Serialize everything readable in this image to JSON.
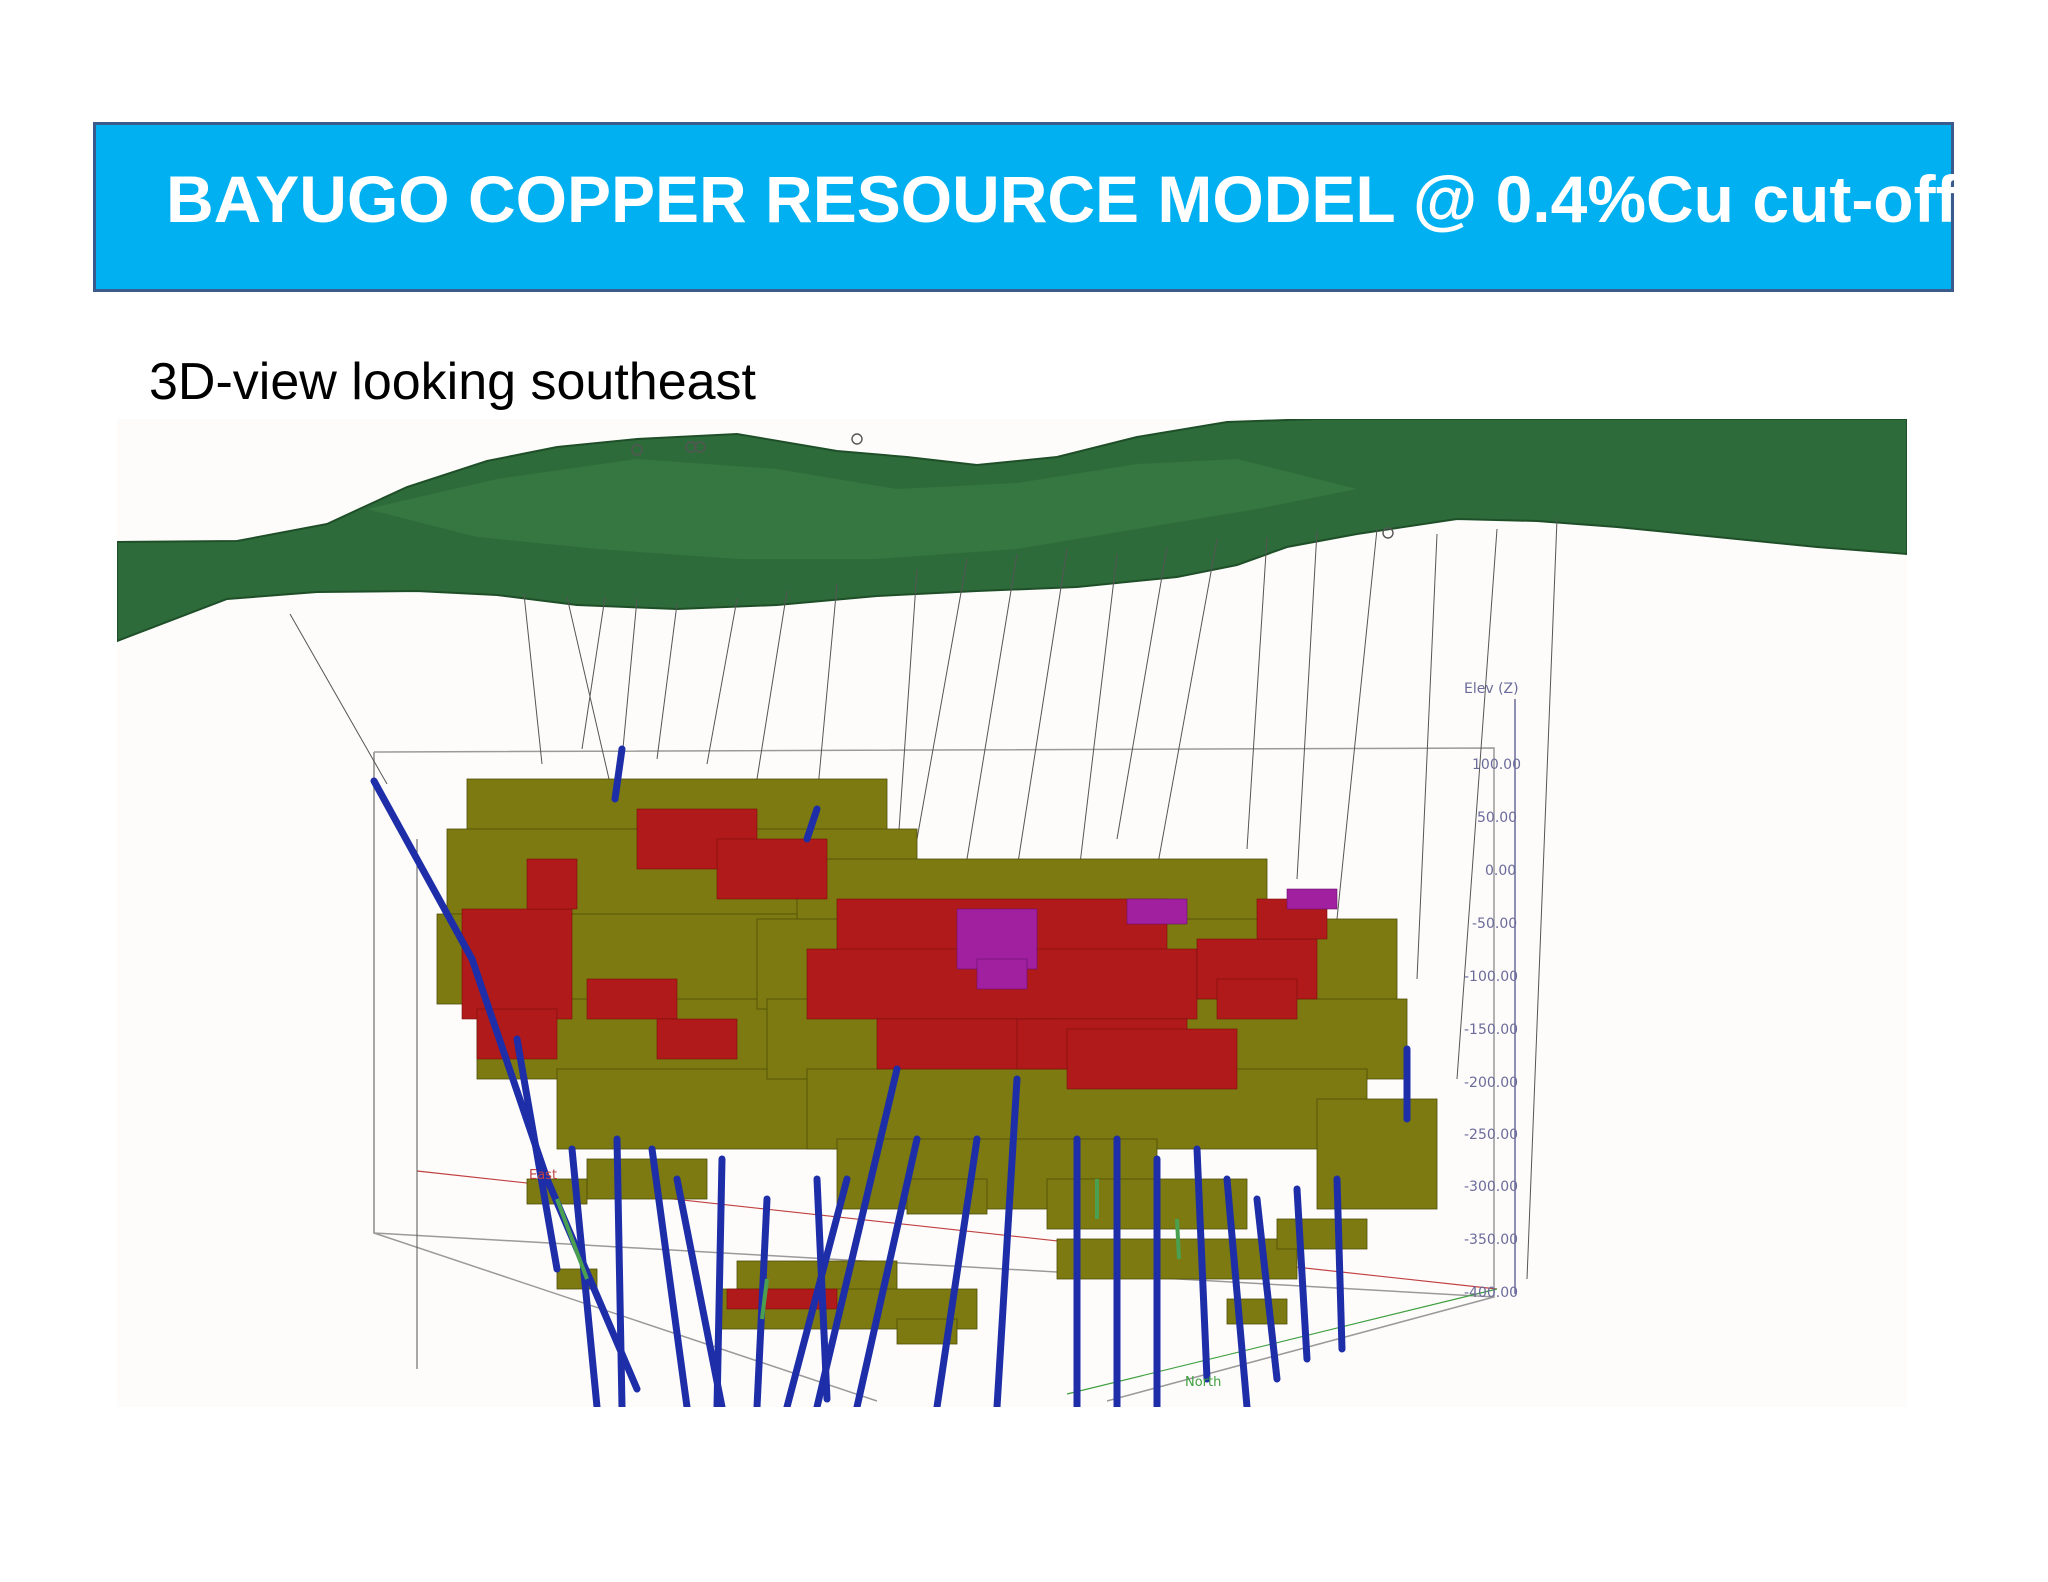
{
  "slide": {
    "title": "BAYUGO COPPER RESOURCE MODEL @ 0.4%Cu cut-off",
    "subtitle": "3D-view looking southeast"
  },
  "viewer": {
    "elevation_axis": {
      "label": "Elev (Z)",
      "ticks": [
        "100.00",
        "50.00",
        "0.00",
        "-50.00",
        "-100.00",
        "-150.00",
        "-200.00",
        "-250.00",
        "-300.00",
        "-350.00",
        "-400.00"
      ]
    },
    "east_label": "East",
    "north_label": "North",
    "colors": {
      "topography": "#2e6b3a",
      "low_grade_block": "#7c7a10",
      "medium_grade_block": "#b01a1a",
      "high_grade_block": "#a020a0",
      "drillhole": "#1e2ea8",
      "bounding_box": "#9a9a9a"
    }
  }
}
